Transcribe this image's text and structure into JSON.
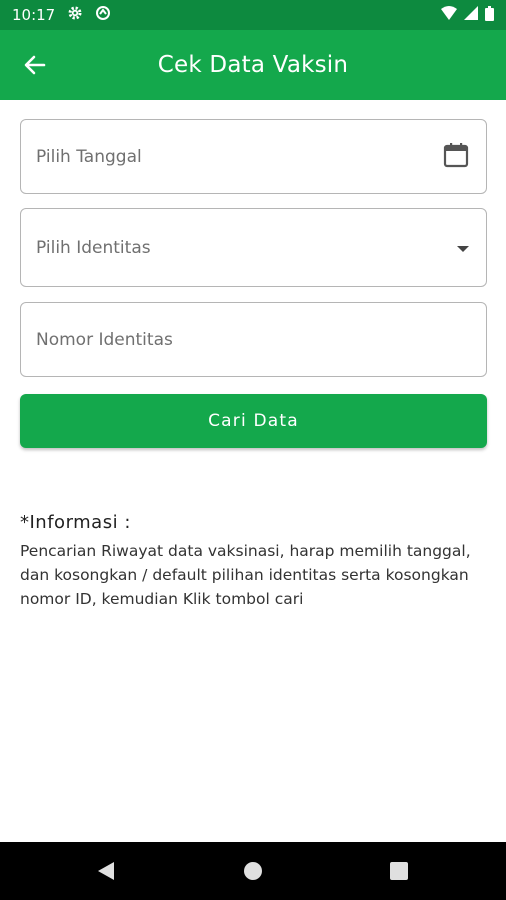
{
  "status_bar": {
    "time": "10:17",
    "icons": [
      "settings-icon",
      "sync-icon",
      "wifi-icon",
      "signal-icon",
      "battery-icon"
    ]
  },
  "app_bar": {
    "title": "Cek Data Vaksin",
    "back_icon": "arrow-left-icon",
    "background_color": "#14a84c"
  },
  "form": {
    "date_placeholder": "Pilih Tanggal",
    "date_icon": "calendar-icon",
    "identity_placeholder": "Pilih Identitas",
    "identity_icon": "dropdown-arrow-icon",
    "number_placeholder": "Nomor Identitas",
    "search_button_label": "Cari Data"
  },
  "info": {
    "title": "*Informasi :",
    "body": "Pencarian Riwayat data vaksinasi, harap memilih tanggal, dan kosongkan / default pilihan identitas serta kosongkan nomor ID, kemudian Klik tombol cari"
  },
  "nav_bar": {
    "icons": [
      "back-triangle-icon",
      "home-circle-icon",
      "recents-square-icon"
    ]
  }
}
